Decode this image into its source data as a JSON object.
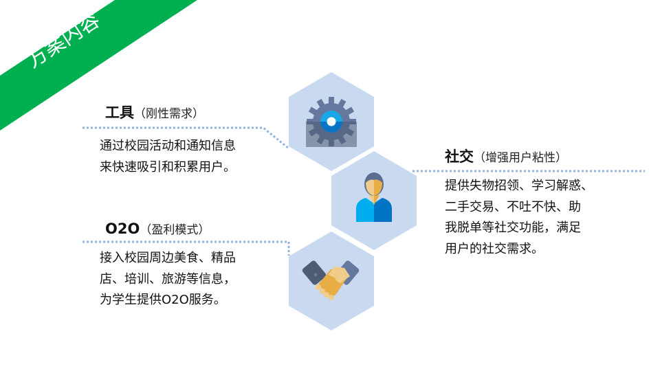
{
  "ribbon": {
    "title": "方案内容",
    "color": "#00b050"
  },
  "hex_color": "#c9daf0",
  "dotted_color": "#8fb2e0",
  "sections": [
    {
      "title": "工具",
      "subtitle": "（刚性需求）",
      "lines": [
        "通过校园活动和通知信息",
        "来快速吸引和积累用户。"
      ],
      "icon": "gear-icon"
    },
    {
      "title": "社交",
      "subtitle": "（增强用户粘性）",
      "lines": [
        "提供失物招领、学习解惑、",
        "二手交易、不吐不快、助",
        "我脱单等社交功能，满足",
        "用户的社交需求。"
      ],
      "icon": "person-icon"
    },
    {
      "title": "O2O",
      "subtitle": "（盈利模式）",
      "lines": [
        "接入校园周边美食、精品",
        "店、培训、旅游等信息，",
        "为学生提供O2O服务。"
      ],
      "icon": "handshake-icon"
    }
  ]
}
